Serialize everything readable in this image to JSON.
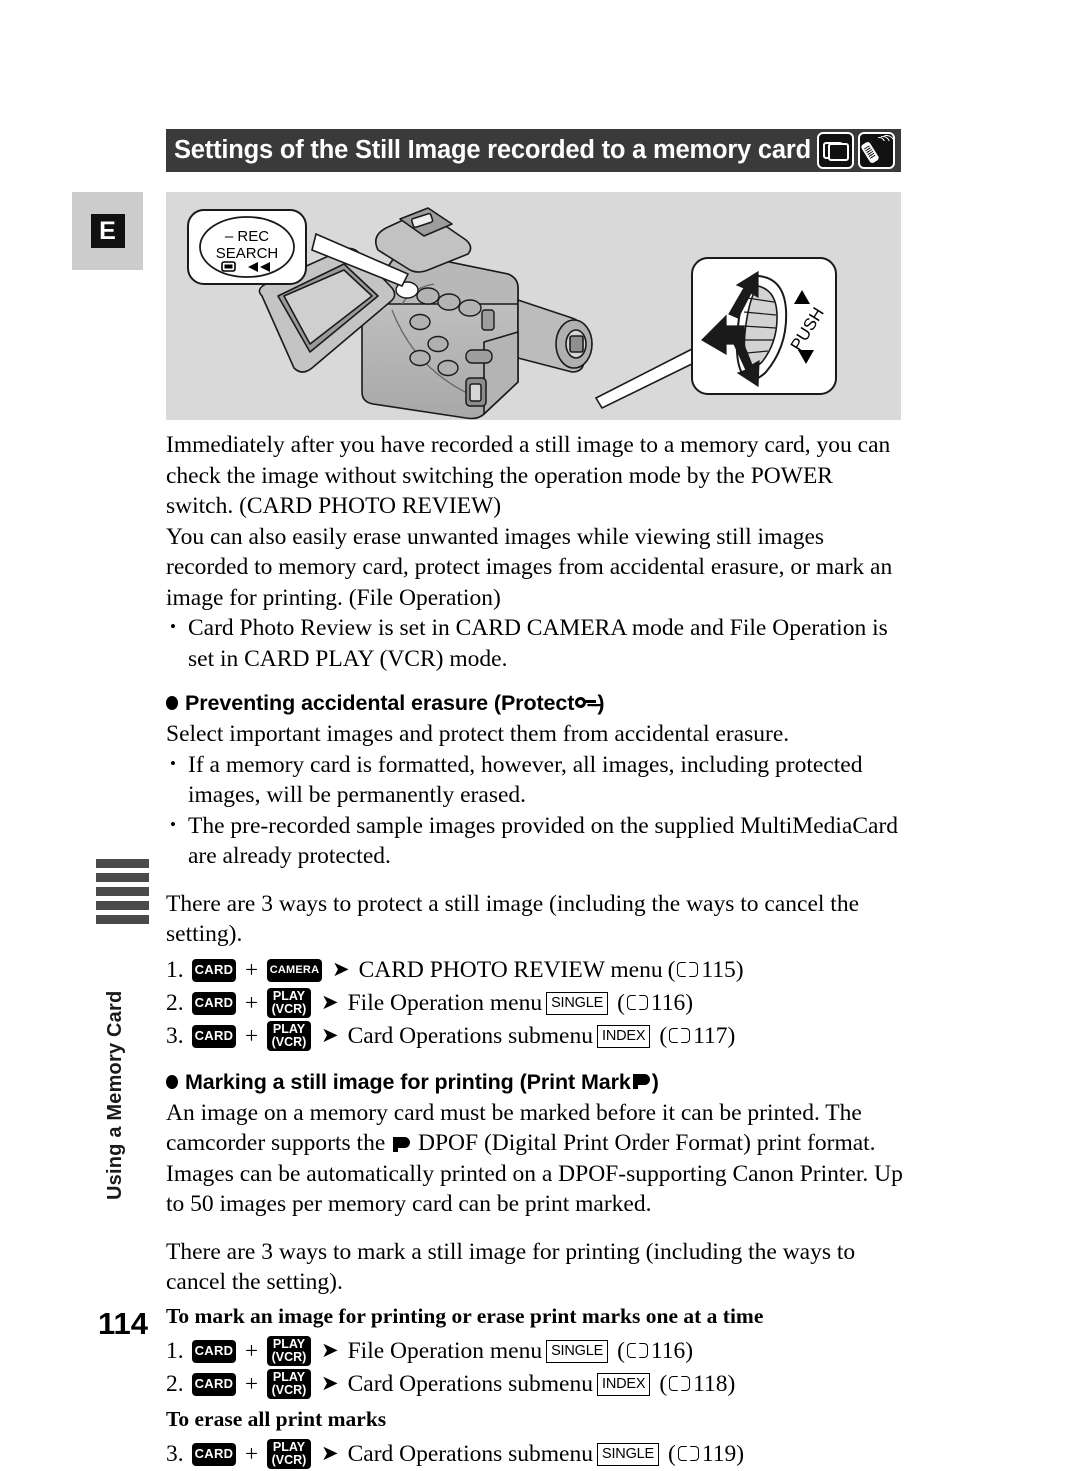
{
  "header": {
    "title": "Settings of the Still Image recorded to a memory card",
    "icons": [
      {
        "name": "card-stack-icon",
        "label": "card-stack"
      },
      {
        "name": "remote-control-icon",
        "label": "wireless-remote"
      }
    ]
  },
  "language_tab": {
    "label": "E"
  },
  "illustration": {
    "callout_rec_search": {
      "line1": "– REC",
      "line2": "SEARCH"
    },
    "callout_push": {
      "label": "PUSH"
    }
  },
  "sidebar": {
    "vertical_title": "Using a Memory Card",
    "tab_mark_count": 5
  },
  "body": {
    "intro_paragraph_1": "Immediately after you have recorded a still image to a memory card, you can check the image without switching the operation mode by the POWER switch. (CARD PHOTO REVIEW)",
    "intro_paragraph_2": "You can also easily erase unwanted images while viewing still images recorded to memory card, protect images from accidental erasure, or mark an image for printing. (File Operation)",
    "intro_bullets": [
      "Card Photo Review is set in CARD CAMERA mode and File Operation is set in CARD PLAY (VCR) mode."
    ]
  },
  "protect_section": {
    "heading_pre": "Preventing accidental erasure (Protect",
    "heading_post": ")",
    "heading_icon": "key-icon",
    "lead": "Select important images and protect them from accidental erasure.",
    "bullets": [
      "If a memory card is formatted, however, all images, including protected images, will be permanently erased.",
      "The pre-recorded sample images provided on the supplied MultiMediaCard are already protected."
    ],
    "ways_line": "There are 3 ways to protect a still image (including the ways to cancel the setting).",
    "steps": [
      {
        "num": "1.",
        "key1": "CARD",
        "key2_line1": "CAMERA",
        "key2_line2": "",
        "target": "CARD PHOTO REVIEW menu",
        "tag": "",
        "page": "115"
      },
      {
        "num": "2.",
        "key1": "CARD",
        "key2_line1": "PLAY",
        "key2_line2": "(VCR)",
        "target": "File Operation menu",
        "tag": "SINGLE",
        "page": "116"
      },
      {
        "num": "3.",
        "key1": "CARD",
        "key2_line1": "PLAY",
        "key2_line2": "(VCR)",
        "target": "Card Operations submenu",
        "tag": "INDEX",
        "page": "117"
      }
    ]
  },
  "printmark_section": {
    "heading_pre": "Marking a still image for printing (Print Mark",
    "heading_post": ")",
    "heading_icon": "print-mark-icon",
    "paragraph_a": "An image on a memory card must be marked before it can be printed. The camcorder supports the",
    "paragraph_b": "DPOF (Digital Print Order Format) print format. Images can be automatically printed on a DPOF-supporting Canon Printer. Up to 50 images per memory card can be print marked.",
    "ways_line": "There are 3 ways to mark a still image for printing (including the ways to cancel the setting).",
    "subhead_one_at_a_time": "To mark an image for printing or erase print marks one at a time",
    "subhead_erase_all": "To erase all print marks",
    "steps_one_at_a_time": [
      {
        "num": "1.",
        "key1": "CARD",
        "key2_line1": "PLAY",
        "key2_line2": "(VCR)",
        "target": "File Operation menu",
        "tag": "SINGLE",
        "page": "116"
      },
      {
        "num": "2.",
        "key1": "CARD",
        "key2_line1": "PLAY",
        "key2_line2": "(VCR)",
        "target": "Card Operations submenu",
        "tag": "INDEX",
        "page": "118"
      }
    ],
    "steps_erase_all": [
      {
        "num": "3.",
        "key1": "CARD",
        "key2_line1": "PLAY",
        "key2_line2": "(VCR)",
        "target": "Card Operations submenu",
        "tag": "SINGLE",
        "page": "119"
      }
    ]
  },
  "footer": {
    "page_number": "114"
  },
  "colors": {
    "header_bar": "#3a3a3a",
    "panel_gray": "#d9d9d9",
    "tab_gray": "#cccccc",
    "mark_gray": "#4a4a4a"
  }
}
